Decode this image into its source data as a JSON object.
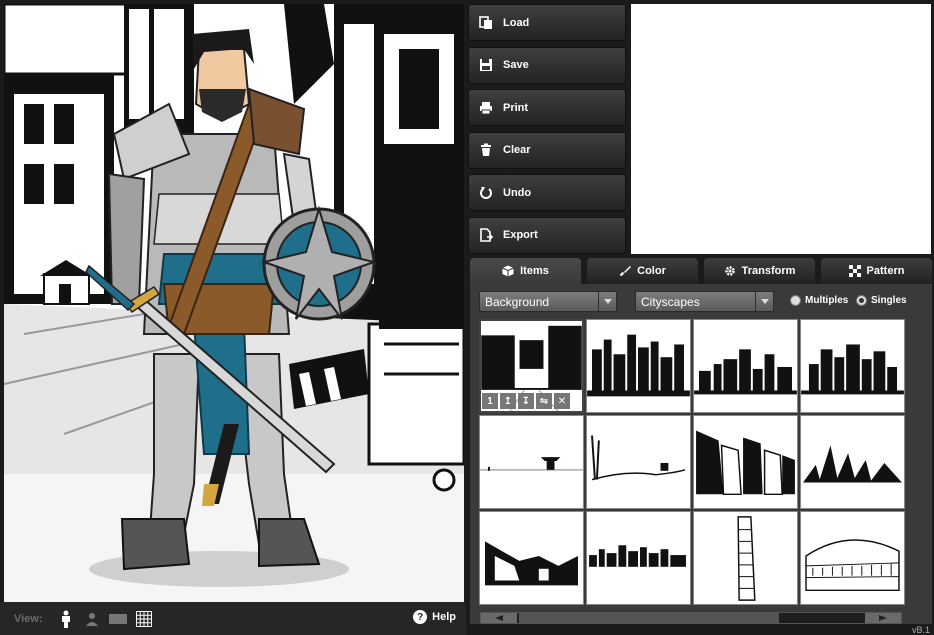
{
  "toolbar": {
    "load": "Load",
    "save": "Save",
    "print": "Print",
    "clear": "Clear",
    "undo": "Undo",
    "export": "Export"
  },
  "tabs": {
    "items": "Items",
    "color": "Color",
    "transform": "Transform",
    "pattern": "Pattern",
    "active": "Items"
  },
  "filters": {
    "category": "Background",
    "subcategory": "Cityscapes",
    "mode_multiples": "Multiples",
    "mode_singles": "Singles",
    "selected_mode": "Singles"
  },
  "thumb_tools": {
    "layer": "1"
  },
  "viewbar": {
    "label": "View:",
    "help": "Help"
  },
  "version": "vB.1",
  "colors": {
    "panel_bg": "#3a3a3a",
    "button_top": "#3f3f3f",
    "button_bottom": "#232323",
    "accent_teal": "#1f6f8b"
  }
}
